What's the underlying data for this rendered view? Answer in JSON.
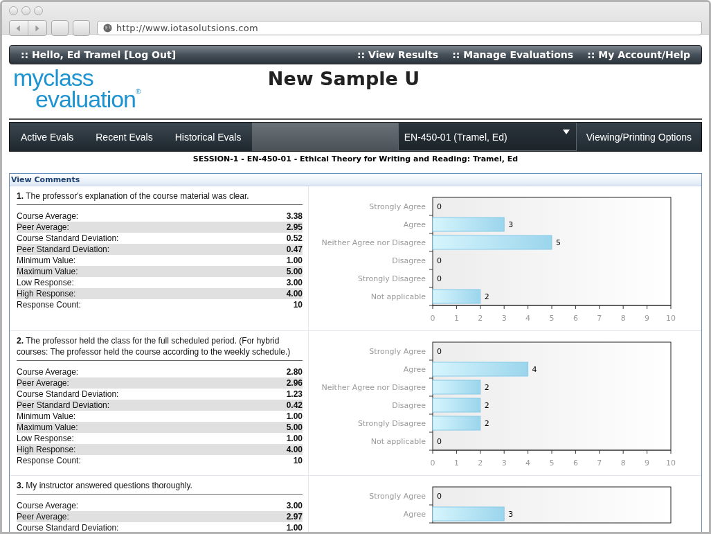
{
  "browser": {
    "url": "http://www.iotasolutsions.com"
  },
  "top_bar": {
    "greeting": ":: Hello, Ed Tramel [Log Out]",
    "links": [
      ":: View Results",
      ":: Manage Evaluations",
      ":: My Account/Help"
    ]
  },
  "logo": {
    "line1": "myclass",
    "line2": "evaluation$^{®}$"
  },
  "title": "New Sample U",
  "nav": {
    "tabs": [
      {
        "label": "Active Evals",
        "selected": false
      },
      {
        "label": "Recent Evals",
        "selected": false
      },
      {
        "label": "Historical Evals",
        "selected": false
      }
    ],
    "course_select": {
      "value": "EN-450-01 (Tramel, Ed)"
    },
    "options_button": "Viewing/Printing Options"
  },
  "session_title": "SESSION-1 - EN-450-01 - Ethical Theory for Writing and Reading: Tramel, Ed",
  "comments_header": "View Comments",
  "questions": [
    {
      "text": "**1.** The professor's explanation of the course material was clear.",
      "stats": [
        {
          "label": "Course Average:",
          "value": "3.38"
        },
        {
          "label": "Peer Average:",
          "value": "2.95"
        },
        {
          "label": "Course Standard Deviation:",
          "value": "0.52"
        },
        {
          "label": "Peer Standard Deviation:",
          "value": "0.47"
        },
        {
          "label": "Minimum Value:",
          "value": "1.00"
        },
        {
          "label": "Maximum Value:",
          "value": "5.00"
        },
        {
          "label": "Low Response:",
          "value": "3.00"
        },
        {
          "label": "High Response:",
          "value": "4.00"
        },
        {
          "label": "Response Count:",
          "value": "10"
        }
      ],
      "chart_data": {
        "type": "bar",
        "orientation": "horizontal",
        "categories": [
          "Strongly Agree",
          "Agree",
          "Neither Agree nor Disagree",
          "Disagree",
          "Strongly Disagree",
          "Not applicable"
        ],
        "values": [
          0,
          3,
          5,
          0,
          0,
          2
        ],
        "xlim": [
          0,
          10
        ],
        "xticks": [
          0,
          1,
          2,
          3,
          4,
          5,
          6,
          7,
          8,
          9,
          10
        ],
        "data_labels": true
      }
    },
    {
      "text": "**2.** The professor held the class for the full scheduled period. (For hybrid courses: The professor held the course according to the weekly schedule.)",
      "stats": [
        {
          "label": "Course Average:",
          "value": "2.80"
        },
        {
          "label": "Peer Average:",
          "value": "2.96"
        },
        {
          "label": "Course Standard Deviation:",
          "value": "1.23"
        },
        {
          "label": "Peer Standard Deviation:",
          "value": "0.42"
        },
        {
          "label": "Minimum Value:",
          "value": "1.00"
        },
        {
          "label": "Maximum Value:",
          "value": "5.00"
        },
        {
          "label": "Low Response:",
          "value": "1.00"
        },
        {
          "label": "High Response:",
          "value": "4.00"
        },
        {
          "label": "Response Count:",
          "value": "10"
        }
      ],
      "chart_data": {
        "type": "bar",
        "orientation": "horizontal",
        "categories": [
          "Strongly Agree",
          "Agree",
          "Neither Agree nor Disagree",
          "Disagree",
          "Strongly Disagree",
          "Not applicable"
        ],
        "values": [
          0,
          4,
          2,
          2,
          2,
          0
        ],
        "xlim": [
          0,
          10
        ],
        "xticks": [
          0,
          1,
          2,
          3,
          4,
          5,
          6,
          7,
          8,
          9,
          10
        ],
        "data_labels": true
      }
    },
    {
      "text": "**3.** My instructor answered questions thoroughly.",
      "stats": [
        {
          "label": "Course Average:",
          "value": "3.00"
        },
        {
          "label": "Peer Average:",
          "value": "2.97"
        },
        {
          "label": "Course Standard Deviation:",
          "value": "1.00"
        }
      ],
      "chart_data": {
        "type": "bar",
        "orientation": "horizontal",
        "categories": [
          "Strongly Agree",
          "Agree"
        ],
        "values": [
          0,
          3
        ],
        "xlim": [
          0,
          10
        ],
        "data_labels": true
      }
    }
  ]
}
